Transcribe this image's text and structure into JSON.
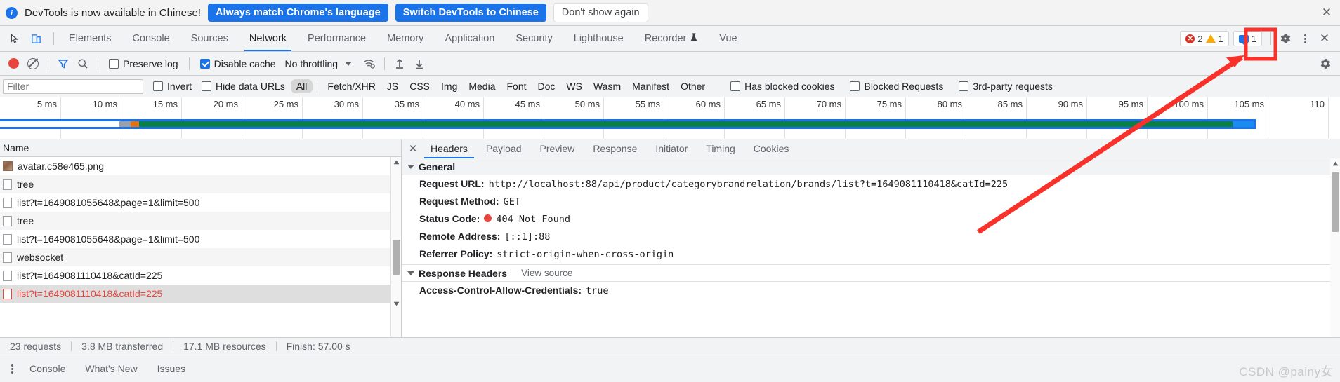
{
  "infobar": {
    "icon": "info-icon",
    "message": "DevTools is now available in Chinese!",
    "primary_button": "Always match Chrome's language",
    "secondary_button": "Switch DevTools to Chinese",
    "dismiss_button": "Don't show again",
    "close_icon": "✕"
  },
  "tabstrip": {
    "inspect_icon": "inspect-cursor-icon",
    "device_icon": "device-toolbar-icon",
    "tabs": [
      {
        "label": "Elements",
        "active": false
      },
      {
        "label": "Console",
        "active": false
      },
      {
        "label": "Sources",
        "active": false
      },
      {
        "label": "Network",
        "active": true
      },
      {
        "label": "Performance",
        "active": false
      },
      {
        "label": "Memory",
        "active": false
      },
      {
        "label": "Application",
        "active": false
      },
      {
        "label": "Security",
        "active": false
      },
      {
        "label": "Lighthouse",
        "active": false
      },
      {
        "label": "Recorder",
        "active": false,
        "badge_icon": "flask-icon"
      },
      {
        "label": "Vue",
        "active": false
      }
    ],
    "error_count": "2",
    "warning_count": "1",
    "message_count": "1",
    "settings_icon": "gear-icon",
    "more_icon": "kebab-menu-icon",
    "close_icon": "✕"
  },
  "network_toolbar": {
    "record_icon": "record-stop-icon",
    "clear_icon": "clear-icon",
    "filter_icon": "funnel-filter-icon",
    "search_icon": "search-icon",
    "preserve_log": {
      "label": "Preserve log",
      "checked": false
    },
    "disable_cache": {
      "label": "Disable cache",
      "checked": true
    },
    "throttling": {
      "value": "No throttling",
      "caret_icon": "chevron-down-icon"
    },
    "wifi_icon": "network-conditions-icon",
    "import_icon": "import-har-icon",
    "export_icon": "export-har-icon",
    "settings_icon": "gear-icon"
  },
  "filter_row": {
    "filter_placeholder": "Filter",
    "filter_value": "",
    "invert": {
      "label": "Invert",
      "checked": false
    },
    "hide_data_urls": {
      "label": "Hide data URLs",
      "checked": false
    },
    "types": [
      {
        "label": "All",
        "active": true
      },
      {
        "label": "Fetch/XHR",
        "active": false
      },
      {
        "label": "JS",
        "active": false
      },
      {
        "label": "CSS",
        "active": false
      },
      {
        "label": "Img",
        "active": false
      },
      {
        "label": "Media",
        "active": false
      },
      {
        "label": "Font",
        "active": false
      },
      {
        "label": "Doc",
        "active": false
      },
      {
        "label": "WS",
        "active": false
      },
      {
        "label": "Wasm",
        "active": false
      },
      {
        "label": "Manifest",
        "active": false
      },
      {
        "label": "Other",
        "active": false
      }
    ],
    "has_blocked_cookies": {
      "label": "Has blocked cookies",
      "checked": false
    },
    "blocked_requests": {
      "label": "Blocked Requests",
      "checked": false
    },
    "third_party_requests": {
      "label": "3rd-party requests",
      "checked": false
    }
  },
  "overview": {
    "ticks": [
      "5 ms",
      "10 ms",
      "15 ms",
      "20 ms",
      "25 ms",
      "30 ms",
      "35 ms",
      "40 ms",
      "45 ms",
      "50 ms",
      "55 ms",
      "60 ms",
      "65 ms",
      "70 ms",
      "75 ms",
      "80 ms",
      "85 ms",
      "90 ms",
      "95 ms",
      "100 ms",
      "105 ms",
      "110"
    ]
  },
  "request_list": {
    "column_header": "Name",
    "rows": [
      {
        "name": "avatar.c58e465.png",
        "icon": "image-file-icon",
        "error": false,
        "selected": false
      },
      {
        "name": "tree",
        "icon": "document-file-icon",
        "error": false,
        "selected": false
      },
      {
        "name": "list?t=1649081055648&page=1&limit=500",
        "icon": "document-file-icon",
        "error": false,
        "selected": false
      },
      {
        "name": "tree",
        "icon": "document-file-icon",
        "error": false,
        "selected": false
      },
      {
        "name": "list?t=1649081055648&page=1&limit=500",
        "icon": "document-file-icon",
        "error": false,
        "selected": false
      },
      {
        "name": "websocket",
        "icon": "document-file-icon",
        "error": false,
        "selected": false
      },
      {
        "name": "list?t=1649081110418&catId=225",
        "icon": "document-file-icon",
        "error": false,
        "selected": false
      },
      {
        "name": "list?t=1649081110418&catId=225",
        "icon": "document-file-icon",
        "error": true,
        "selected": true
      }
    ]
  },
  "details_panel": {
    "close_icon": "✕",
    "tabs": [
      {
        "label": "Headers",
        "active": true
      },
      {
        "label": "Payload",
        "active": false
      },
      {
        "label": "Preview",
        "active": false
      },
      {
        "label": "Response",
        "active": false
      },
      {
        "label": "Initiator",
        "active": false
      },
      {
        "label": "Timing",
        "active": false
      },
      {
        "label": "Cookies",
        "active": false
      }
    ],
    "general": {
      "title": "General",
      "expand_icon": "triangle-down-icon",
      "rows": [
        {
          "key": "Request URL:",
          "value": "http://localhost:88/api/product/categorybrandrelation/brands/list?t=1649081110418&catId=225"
        },
        {
          "key": "Request Method:",
          "value": "GET"
        },
        {
          "key": "Status Code:",
          "value": "404 Not Found",
          "status_dot": "#e8453c"
        },
        {
          "key": "Remote Address:",
          "value": "[::1]:88"
        },
        {
          "key": "Referrer Policy:",
          "value": "strict-origin-when-cross-origin"
        }
      ]
    },
    "response_headers": {
      "title": "Response Headers",
      "expand_icon": "triangle-down-icon",
      "view_source": "View source",
      "rows": [
        {
          "key": "Access-Control-Allow-Credentials:",
          "value": "true"
        }
      ]
    }
  },
  "statusbar": {
    "requests": "23 requests",
    "transferred": "3.8 MB transferred",
    "resources": "17.1 MB resources",
    "finish": "Finish: 57.00 s"
  },
  "drawer": {
    "more_icon": "kebab-menu-icon",
    "tabs": [
      {
        "label": "Console"
      },
      {
        "label": "What's New"
      },
      {
        "label": "Issues"
      }
    ]
  },
  "watermark": "CSDN @painy女",
  "annotations": {
    "highlight_box_color": "#f8312a",
    "arrow_color": "#f8312a",
    "target": "gear-icon"
  },
  "colors": {
    "accent_blue": "#1a73e8",
    "error_red": "#e8453c",
    "warning_yellow": "#f9ab00",
    "timeline_green": "#0b8043",
    "toolbar_bg": "#f1f3f4"
  }
}
